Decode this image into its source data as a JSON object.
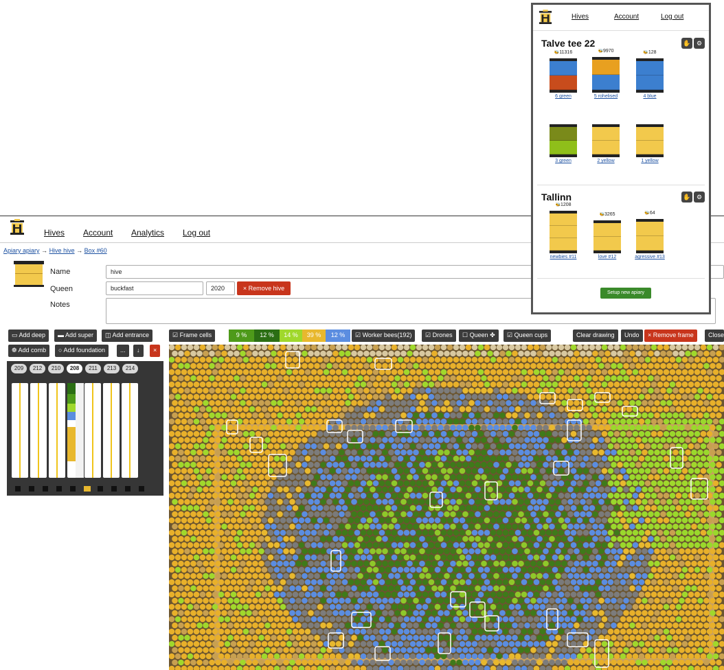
{
  "nav": {
    "hives": "Hives",
    "account": "Account",
    "analytics": "Analytics",
    "logout": "Log out"
  },
  "breadcrumb": {
    "apiary": "Apiary apiary",
    "hive": "Hive hive",
    "box": "Box #60",
    "arrow": "→"
  },
  "form": {
    "name_label": "Name",
    "name_value": "hive",
    "queen_label": "Queen",
    "queen_value": "buckfast",
    "queen_year": "2020",
    "notes_label": "Notes",
    "notes_value": "",
    "remove_hive": "× Remove hive"
  },
  "box_toolbar": {
    "add_deep": "Add deep",
    "add_super": "Add super",
    "add_entrance": "Add entrance",
    "add_comb": "Add comb",
    "add_foundation": "Add foundation",
    "more": "...",
    "down": "↓",
    "remove": "×"
  },
  "frame_numbers": [
    "209",
    "212",
    "210",
    "208",
    "211",
    "213",
    "214"
  ],
  "active_frame": "208",
  "frame_toolbar": {
    "frame_cells": "Frame cells",
    "percentages": [
      {
        "label": "9 %",
        "color": "#4e9a1a"
      },
      {
        "label": "12 %",
        "color": "#2b6e14"
      },
      {
        "label": "14 %",
        "color": "#a0d82c"
      },
      {
        "label": "39 %",
        "color": "#e8b82e"
      },
      {
        "label": "12 %",
        "color": "#5b8de0"
      }
    ],
    "worker_bees": "Worker bees(192)",
    "drones": "Drones",
    "queen": "Queen",
    "queen_cups": "Queen cups",
    "clear_drawing": "Clear drawing",
    "undo": "Undo",
    "remove_frame": "× Remove frame",
    "close": "Close"
  },
  "overlay": {
    "nav": {
      "hives": "Hives",
      "account": "Account",
      "logout": "Log out"
    },
    "apiaries": [
      {
        "name": "Talve tee 22",
        "hives": [
          {
            "name": "6 green",
            "count": "11316"
          },
          {
            "name": "5 rohelised",
            "count": "9970"
          },
          {
            "name": "4 blue",
            "count": "128"
          },
          {
            "name": "3 green",
            "count": ""
          },
          {
            "name": "2 yellow",
            "count": ""
          },
          {
            "name": "1 yellow",
            "count": ""
          }
        ]
      },
      {
        "name": "Tallinn",
        "hives": [
          {
            "name": "newbies #11",
            "count": "1208"
          },
          {
            "name": "love #12",
            "count": "3265"
          },
          {
            "name": "agressive #13",
            "count": "64"
          }
        ]
      }
    ],
    "setup_button": "Setup new apiary"
  },
  "colors": {
    "hive_yellow": "#f2c94c",
    "hive_blue": "#3c7fcf",
    "hive_red": "#c84c1c",
    "hive_green": "#8fbf1a",
    "hive_olive": "#7a8a1a",
    "hive_orange": "#e8a020",
    "accent_red": "#c8351c",
    "setup_green": "#3a8a2a"
  },
  "icons": {
    "bee": "bee-icon",
    "logo": "beehive-logo-icon",
    "hand": "hand-icon",
    "settings": "gear-icon"
  }
}
